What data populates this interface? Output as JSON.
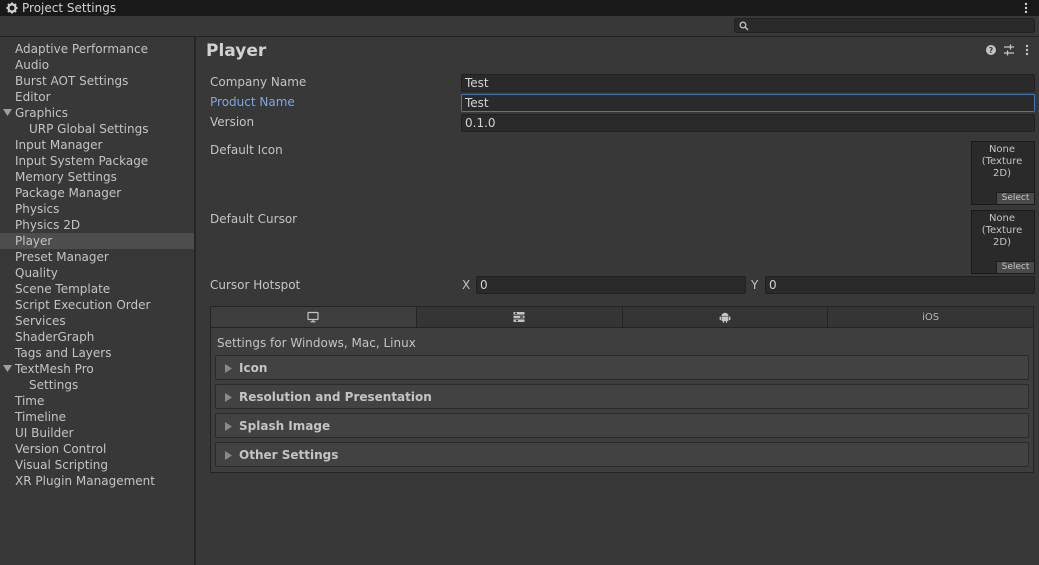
{
  "window": {
    "title": "Project Settings"
  },
  "search": {
    "value": "",
    "placeholder": ""
  },
  "sidebar": {
    "items": [
      {
        "label": "Adaptive Performance",
        "level": 0
      },
      {
        "label": "Audio",
        "level": 0
      },
      {
        "label": "Burst AOT Settings",
        "level": 0
      },
      {
        "label": "Editor",
        "level": 0
      },
      {
        "label": "Graphics",
        "level": 0,
        "expanded": true
      },
      {
        "label": "URP Global Settings",
        "level": 1
      },
      {
        "label": "Input Manager",
        "level": 0
      },
      {
        "label": "Input System Package",
        "level": 0
      },
      {
        "label": "Memory Settings",
        "level": 0
      },
      {
        "label": "Package Manager",
        "level": 0
      },
      {
        "label": "Physics",
        "level": 0
      },
      {
        "label": "Physics 2D",
        "level": 0
      },
      {
        "label": "Player",
        "level": 0,
        "selected": true
      },
      {
        "label": "Preset Manager",
        "level": 0
      },
      {
        "label": "Quality",
        "level": 0
      },
      {
        "label": "Scene Template",
        "level": 0
      },
      {
        "label": "Script Execution Order",
        "level": 0
      },
      {
        "label": "Services",
        "level": 0
      },
      {
        "label": "ShaderGraph",
        "level": 0
      },
      {
        "label": "Tags and Layers",
        "level": 0
      },
      {
        "label": "TextMesh Pro",
        "level": 0,
        "expanded": true
      },
      {
        "label": "Settings",
        "level": 1
      },
      {
        "label": "Time",
        "level": 0
      },
      {
        "label": "Timeline",
        "level": 0
      },
      {
        "label": "UI Builder",
        "level": 0
      },
      {
        "label": "Version Control",
        "level": 0
      },
      {
        "label": "Visual Scripting",
        "level": 0
      },
      {
        "label": "XR Plugin Management",
        "level": 0
      }
    ]
  },
  "main": {
    "title": "Player",
    "icons": [
      "help-icon",
      "preset-icon",
      "more-menu-icon"
    ],
    "company_name": {
      "label": "Company Name",
      "value": "Test"
    },
    "product_name": {
      "label": "Product Name",
      "value": "Test"
    },
    "version": {
      "label": "Version",
      "value": "0.1.0"
    },
    "default_icon": {
      "label": "Default Icon",
      "slot_text": "None\n(Texture 2D)",
      "select_label": "Select"
    },
    "default_cursor": {
      "label": "Default Cursor",
      "slot_text": "None\n(Texture 2D)",
      "select_label": "Select"
    },
    "cursor_hotspot": {
      "label": "Cursor Hotspot",
      "x_label": "X",
      "x_value": "0",
      "y_label": "Y",
      "y_value": "0"
    },
    "platform_tabs": [
      {
        "name": "standalone-icon",
        "label": ""
      },
      {
        "name": "webgl-icon",
        "label": ""
      },
      {
        "name": "android-icon",
        "label": ""
      },
      {
        "name": "ios",
        "label": "iOS"
      }
    ],
    "settings_for": "Settings for Windows, Mac, Linux",
    "sections": [
      "Icon",
      "Resolution and Presentation",
      "Splash Image",
      "Other Settings"
    ]
  },
  "colors": {
    "background": "#383838",
    "field": "#2a2a2a",
    "accent": "#7ea8e0",
    "focus_border": "#3a79bb",
    "text": "#c4c4c4"
  }
}
